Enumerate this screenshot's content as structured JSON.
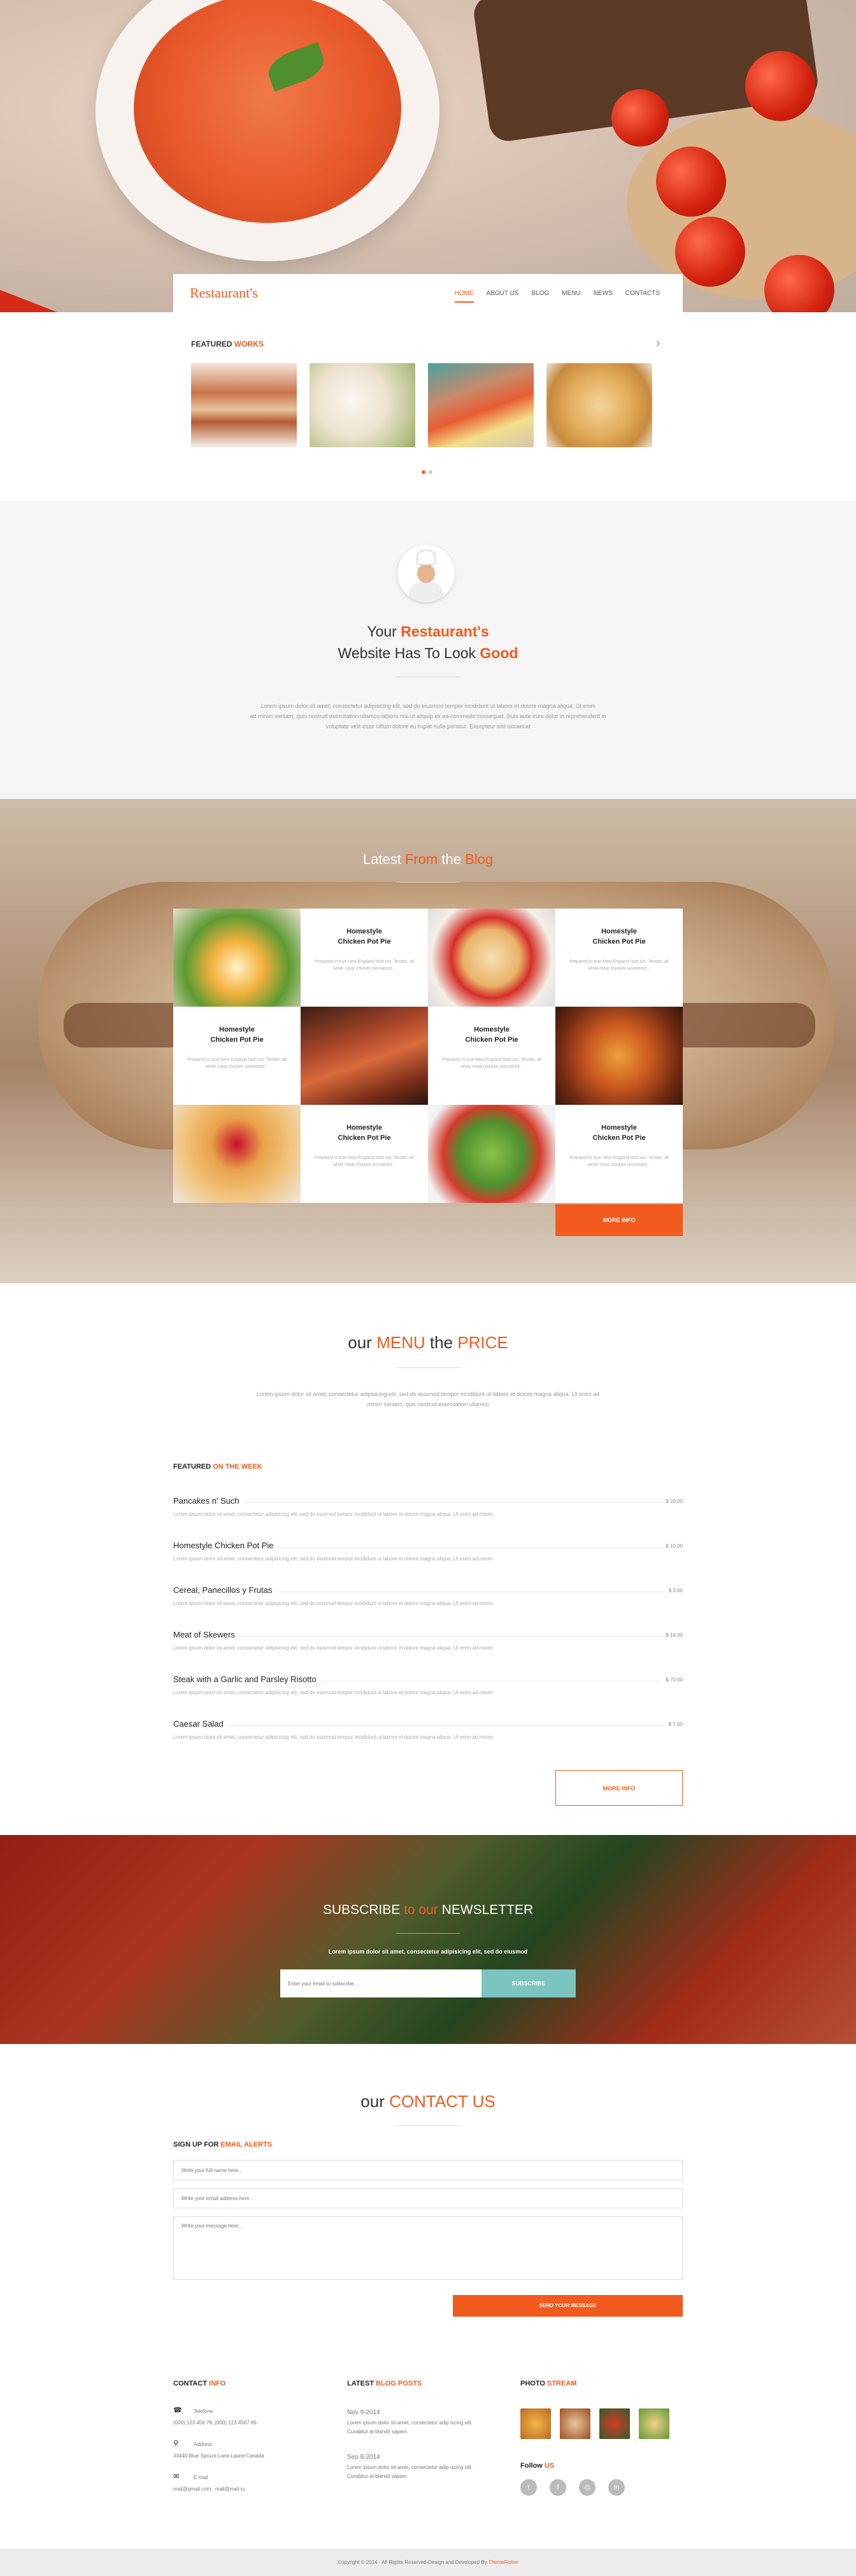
{
  "header": {
    "logo": "Restaurant's",
    "nav": [
      "HOME",
      "ABOUT US",
      "BLOG",
      "MENU",
      "NEWS",
      "CONTACTS"
    ],
    "active": "HOME"
  },
  "featured": {
    "title_a": "FEATURED",
    "title_b": "WORKS",
    "arrow": "›"
  },
  "about": {
    "line1_a": "Your",
    "line1_b": "Restaurant's",
    "line2_a": "Website Has To Look",
    "line2_b": "Good",
    "text1": "Lorem ipsum dolor sit amet, consectetur adipisicing elit, sed do eiusmod tempor incididunt ut labore et dolore magna aliqua. Ut enim",
    "text2": "ad minim veniam, quis nostrud exercitation ullamco laboris nisi ut aliquip ex ea commodo consequat. Duis aute irure dolor in reprehenderit in",
    "text3": "voluptate velit esse cillum dolore eu fugiat nulla pariatur. Excepteur sint occaecat"
  },
  "blog": {
    "title_a": "Latest",
    "title_b": "From",
    "title_c": "the",
    "title_d": "Blog",
    "card_title_1": "Homestyle",
    "card_title_2": "Chicken Pot Pie",
    "card_text": "Prepared in true New England fash ion. Tender, all white meat chicken simmered...",
    "more": "MORE INFO"
  },
  "menu": {
    "title_a": "our",
    "title_b": "MENU",
    "title_c": "the",
    "title_d": "PRICE",
    "intro1": "Lorem ipsum dolor sit amet, consectetur adipisicing elit, sed do eiusmod tempor incididunt ut labore et dolore magna aliqua. Ut enim ad",
    "intro2": "minim veniam, quis nostrud exercitation ullamco",
    "featured_a": "FEATURED",
    "featured_b": "ON THE WEEK",
    "desc": "Lorem ipsum dolor sit amet, consectetur adipisicing elit, sed do eiusmod tempor incididunt ut labore et dolore magna aliqua. Ut enim ad minim",
    "items": [
      {
        "name": "Pancakes n' Such",
        "price": "$ 20.00"
      },
      {
        "name": "Homestyle Chicken Pot Pie",
        "price": "$ 10.00"
      },
      {
        "name": "Cereal, Panecillos y Frutas",
        "price": "$ 3.00"
      },
      {
        "name": "Meat of Skewers",
        "price": "$ 14.00"
      },
      {
        "name": "Steak with a Garlic and Parsley Risotto",
        "price": "$ 70.00"
      },
      {
        "name": "Caesar Salad",
        "price": "$ 7.00"
      }
    ],
    "more": "MORE INFO"
  },
  "newsletter": {
    "title_a": "SUBSCRIBE",
    "title_b": "to our",
    "title_c": "NEWSLETTER",
    "sub": "Lorem ipsum dolor sit amet, consectetur adipisicing elit, sed do eiusmod",
    "placeholder": "Enter your email to subscribe...",
    "button": "SUBSCRIBE"
  },
  "contact": {
    "title_a": "our",
    "title_b": "CONTACT US",
    "signup_a": "SIGN UP FOR",
    "signup_b": "EMAIL ALERTS",
    "name_ph": "Write your full name here...",
    "email_ph": "Write your email address here...",
    "msg_ph": "Write your message here...",
    "send": "SEND YOUR MESSAGE"
  },
  "footer": {
    "contact_a": "CONTACT",
    "contact_b": "INFO",
    "tel_label": "Telefone",
    "tel": "(000) 123 456 78, (000) 123 4567 89",
    "addr_label": "Address",
    "addr": "33440 Blue Spruce Lane Laurel Canada",
    "email_label": "E-mail",
    "email": "mail@gmail.com , mail@mail.ru",
    "posts_a": "LATEST",
    "posts_b": "BLOG POSTS",
    "post1_date": "Nov 9-2014",
    "post2_date": "Sep 8-2014",
    "post_text1": "Lorem ipsum dolor sit amet, consectetur adip iscing elit.",
    "post_text2": "Curabitur at blandit sapien.",
    "photo_a": "PHOTO",
    "photo_b": "STREAM",
    "follow_a": "Follow",
    "follow_b": "US",
    "copyright_a": "Copyright © 2014 - All Rights Reserved-Design and Developed By",
    "copyright_b": "ThemeFisher"
  },
  "colors": {
    "accent": "#f25b1d",
    "teal": "#7bc4c0"
  }
}
